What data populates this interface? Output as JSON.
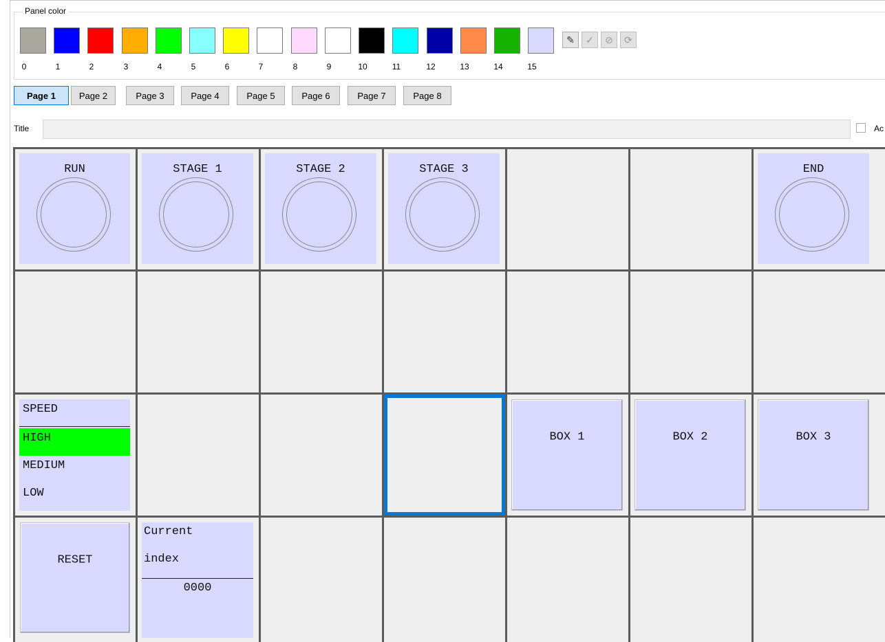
{
  "panel_color": {
    "label": "Panel color",
    "swatches": [
      {
        "num": "0",
        "color": "#a8a89f"
      },
      {
        "num": "1",
        "color": "#0000ff"
      },
      {
        "num": "2",
        "color": "#ff0000"
      },
      {
        "num": "3",
        "color": "#ffad00"
      },
      {
        "num": "4",
        "color": "#00ff00"
      },
      {
        "num": "5",
        "color": "#88ffff"
      },
      {
        "num": "6",
        "color": "#ffff00"
      },
      {
        "num": "7",
        "color": "#ffffff"
      },
      {
        "num": "8",
        "color": "#ffdaff"
      },
      {
        "num": "9",
        "color": "#ffffff"
      },
      {
        "num": "10",
        "color": "#000000"
      },
      {
        "num": "11",
        "color": "#00ffff"
      },
      {
        "num": "12",
        "color": "#0000a8"
      },
      {
        "num": "13",
        "color": "#ff8a4a"
      },
      {
        "num": "14",
        "color": "#16b300"
      },
      {
        "num": "15",
        "color": "#d9d9ff"
      }
    ],
    "tools": [
      {
        "icon": "pencil-icon",
        "glyph": "✎",
        "enabled": true
      },
      {
        "icon": "check-icon",
        "glyph": "✓",
        "enabled": false
      },
      {
        "icon": "cancel-icon",
        "glyph": "⊘",
        "enabled": false
      },
      {
        "icon": "refresh-icon",
        "glyph": "⟳",
        "enabled": false
      }
    ]
  },
  "pages": {
    "tabs": [
      "Page 1",
      "Page 2",
      "Page 3",
      "Page 4",
      "Page 5",
      "Page 6",
      "Page 7",
      "Page 8"
    ],
    "active": "Page 1"
  },
  "title_field": {
    "label": "Title",
    "value": "",
    "checkbox_label": "Ac"
  },
  "grid": {
    "lamps": [
      "RUN",
      "STAGE 1",
      "STAGE 2",
      "STAGE 3",
      "END"
    ],
    "selector": {
      "title": "SPEED",
      "options": [
        "HIGH",
        "MEDIUM",
        "LOW"
      ],
      "selected": "HIGH"
    },
    "buttons": [
      "BOX 1",
      "BOX 2",
      "BOX 3",
      "RESET"
    ],
    "display": {
      "label_line1": "Current",
      "label_line2": "index",
      "value": "0000"
    }
  },
  "colors": {
    "panel_fill": "#d9d9ff",
    "cell_empty": "#efefef",
    "grid_line": "#5b5b5b",
    "selection": "#0a78d2",
    "highlight": "#00ff00"
  }
}
